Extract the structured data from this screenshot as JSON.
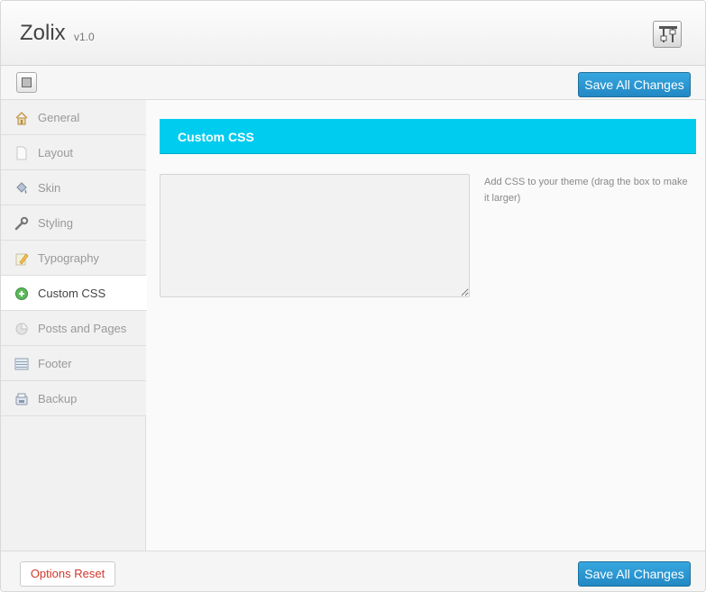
{
  "header": {
    "title": "Zolix",
    "version": "v1.0"
  },
  "toolbar": {
    "save_label": "Save All Changes"
  },
  "sidebar": {
    "items": [
      {
        "label": "General",
        "icon": "home-icon",
        "active": false
      },
      {
        "label": "Layout",
        "icon": "page-icon",
        "active": false
      },
      {
        "label": "Skin",
        "icon": "paint-bucket-icon",
        "active": false
      },
      {
        "label": "Styling",
        "icon": "wrench-icon",
        "active": false
      },
      {
        "label": "Typography",
        "icon": "pencil-icon",
        "active": false
      },
      {
        "label": "Custom CSS",
        "icon": "plus-circle-icon",
        "active": true
      },
      {
        "label": "Posts and Pages",
        "icon": "pie-chart-icon",
        "active": false
      },
      {
        "label": "Footer",
        "icon": "footer-icon",
        "active": false
      },
      {
        "label": "Backup",
        "icon": "backup-icon",
        "active": false
      }
    ]
  },
  "main": {
    "section_title": "Custom CSS",
    "textarea_value": "",
    "help_text": "Add CSS to your theme (drag the box to make it larger)"
  },
  "footer": {
    "reset_label": "Options Reset",
    "save_label": "Save All Changes"
  },
  "colors": {
    "accent": "#00ccef",
    "primary_button": "#2a96d2",
    "reset_text": "#d2372b"
  }
}
